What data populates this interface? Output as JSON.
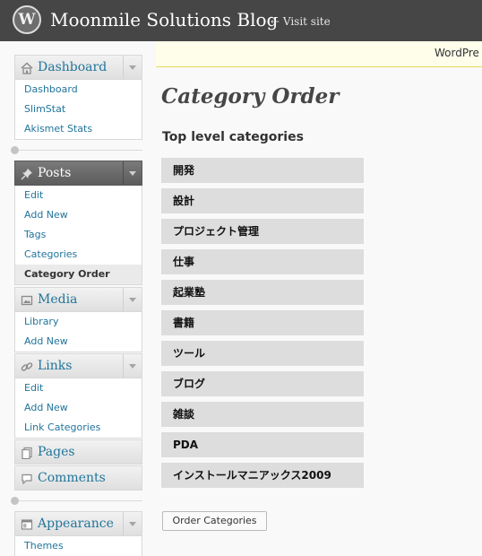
{
  "header": {
    "site_title": "Moonmile Solutions Blog",
    "visit_site": "← Visit site"
  },
  "notice": {
    "text": "WordPre"
  },
  "sidebar": {
    "dashboard": {
      "label": "Dashboard",
      "items": [
        "Dashboard",
        "SlimStat",
        "Akismet Stats"
      ]
    },
    "posts": {
      "label": "Posts",
      "items": [
        "Edit",
        "Add New",
        "Tags",
        "Categories",
        "Category Order"
      ]
    },
    "media": {
      "label": "Media",
      "items": [
        "Library",
        "Add New"
      ]
    },
    "links": {
      "label": "Links",
      "items": [
        "Edit",
        "Add New",
        "Link Categories"
      ]
    },
    "pages": {
      "label": "Pages"
    },
    "comments": {
      "label": "Comments"
    },
    "appearance": {
      "label": "Appearance",
      "items": [
        "Themes"
      ]
    }
  },
  "main": {
    "title": "Category Order",
    "section_title": "Top level categories",
    "categories": [
      "開発",
      "設計",
      "プロジェクト管理",
      "仕事",
      "起業塾",
      "書籍",
      "ツール",
      "ブログ",
      "雑談",
      "PDA",
      "インストールマニアックス2009"
    ],
    "order_button": "Order Categories"
  },
  "colors": {
    "header_bg": "#464646",
    "link": "#21759b",
    "active_menu_bg": "#6b6b6b",
    "category_bg": "#dddddd",
    "notice_bg": "#fffeeb"
  }
}
